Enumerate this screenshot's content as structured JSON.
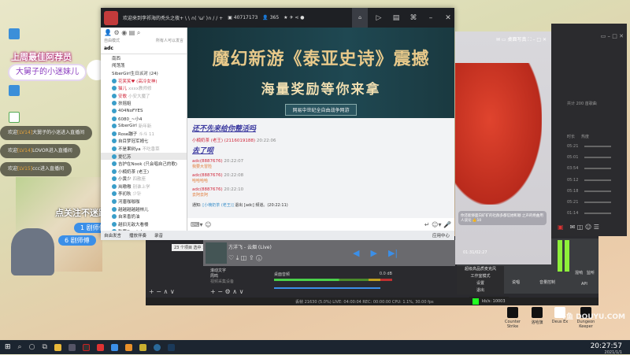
{
  "overlay": {
    "badge": "上周最佳阿荐员",
    "top_fan": "大舅子的小迷妹儿",
    "welcomes": [
      {
        "pre": "欢迎",
        "lv": "[LV14]",
        "name": "大舅子的小迷",
        "post": "进入直播间"
      },
      {
        "pre": "欢迎",
        "lv": "[LV14]",
        "name": "LOVOR",
        "post": "进入直播间"
      },
      {
        "pre": "欢迎",
        "lv": "[LV15]",
        "name": "ccc",
        "post": "进入直播间"
      }
    ],
    "follow": "点关注不迷路",
    "tags": [
      "1 剧师傅",
      "6 剧师傅"
    ]
  },
  "yy": {
    "title": "欢迎来到李祁海的秃头之夜+ \\ \\ ∩( 'ω' )∩ / / +",
    "room_id": "40717173",
    "viewers": "365",
    "mode": "自由模式",
    "mode_hint": "所有人可以发言",
    "room": "adc",
    "channels": [
      "南西",
      "闯荡荡",
      "SiberGirl生日派对 (24)"
    ],
    "users": [
      {
        "n": "花笑笑♥ (高冷女神)",
        "c": "red"
      },
      {
        "n": "猫儿",
        "h": "xxxx教师修",
        "c": "red"
      },
      {
        "n": "安歌",
        "h": "小安大魔了",
        "c": "red"
      },
      {
        "n": "扶摇姐"
      },
      {
        "n": "404NoFYES"
      },
      {
        "n": "6080_~小4"
      },
      {
        "n": "SiberGirl",
        "h": "新年新"
      },
      {
        "n": "Rose蹦子",
        "h": "斗斗 11"
      },
      {
        "n": "自目梦冠军姆七"
      },
      {
        "n": "不是果树ya",
        "h": "不吃香菜"
      },
      {
        "n": "爱忆苏",
        "sel": true
      },
      {
        "n": "吉护在Nook (只会唱自己的歌)"
      },
      {
        "n": "小楠奶茶 (老王)"
      },
      {
        "n": "小黄少",
        "h": "四散座"
      },
      {
        "n": "岚嗷嗷",
        "h": "别谁上学"
      },
      {
        "n": "李初秋",
        "h": "少针"
      },
      {
        "n": "河唐咖咖咖"
      },
      {
        "n": "越越越越越林儿"
      },
      {
        "n": "自来香奶油"
      },
      {
        "n": "越旧无敌大看楼"
      },
      {
        "n": "秋寒Crystal"
      }
    ],
    "banner": {
      "line1": "魔幻新游《泰亚史诗》震撼",
      "line2": "海量奖励等你来拿",
      "tag": "网易中世纪全自由战争网游"
    },
    "chat": [
      {
        "type": "big",
        "text": "还不先来给你整活吗"
      },
      {
        "type": "meta",
        "name": "小楠奶茶 (老王) (2116019188)",
        "time": "20:22:06"
      },
      {
        "type": "big",
        "text": "去了呗"
      },
      {
        "type": "meta",
        "name": "adc(8887676)",
        "time": "20:22:07",
        "msg": "我要大冒险"
      },
      {
        "type": "meta",
        "name": "adc(8887676)",
        "time": "20:22:08",
        "msg": "哈哈哈哈"
      },
      {
        "type": "meta",
        "name": "adc(8887676)",
        "time": "20:22:10",
        "msg": "去阿去阿"
      }
    ],
    "system": {
      "label": "通知:",
      "who": "[小楠奶茶 (老王)]",
      "text": "退出 [adc] 频道。(20:22:11)"
    },
    "bottom": [
      "自由发言",
      "播放伴奏",
      "录音"
    ],
    "app_center": "应用中心"
  },
  "obs": {
    "items_count": "23 个项目",
    "selected": "选中 1 个项目",
    "sources": [
      "滚动文字",
      "周鸣",
      "视频采集设备"
    ],
    "mixer_label": "桌面音频",
    "db": "0.0 dB",
    "status": "丢帧 21630 (5.0%)  LIVE: 04:00:04  REC: 00:00:00  CPU: 1.1%, 30.00 fps"
  },
  "music": {
    "title": "方洋飞 - 云烟 (Live)"
  },
  "player": {
    "time": "01:31/02:27",
    "lyric": "你还能够面向矿矿的社群多都信她彰顺 之声的绝曲用人谈论",
    "likes": "10",
    "buttons": [
      "桌面写真"
    ],
    "song_count": "共计 200 首歌曲",
    "col_time": "时长",
    "col_hot": "热度",
    "durations": [
      "05:21",
      "05:01",
      "03:54",
      "05:12",
      "05:18",
      "05:21",
      "01:14"
    ]
  },
  "mixer": {
    "menu": [
      "超级高品质麦克风",
      "工作室模式",
      "设置",
      "退出"
    ],
    "labels": [
      "说唱",
      "音量控制",
      "混响",
      "监听",
      "API"
    ],
    "kbps": "kb/s: 10003"
  },
  "desktop": {
    "icons": [
      "Counter Strike",
      "洛哈旗",
      "Deus Ex",
      "Dungeon Keeper"
    ]
  },
  "taskbar": {
    "time": "20:27:57",
    "date": "2021/1/1"
  },
  "watermark": "斗鱼 DOUYU.COM"
}
